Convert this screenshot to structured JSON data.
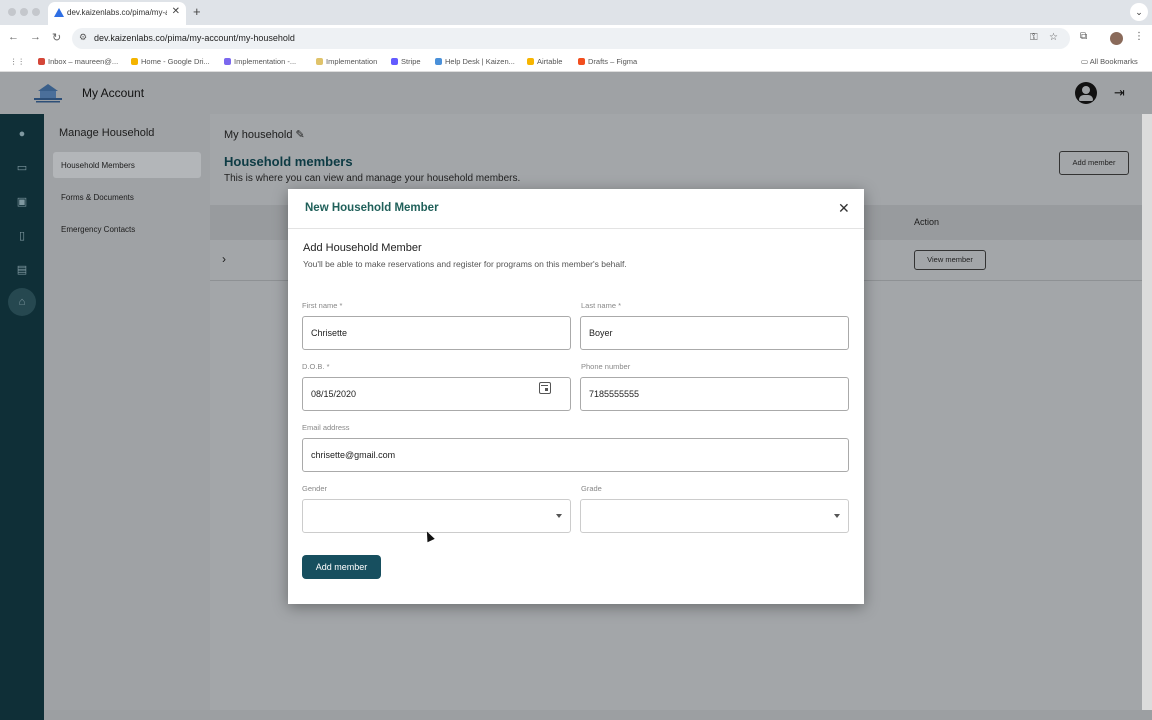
{
  "browser": {
    "tab_title": "dev.kaizenlabs.co/pima/my-a",
    "tab_close": "✕",
    "new_tab": "+",
    "tab_menu": "⌄",
    "url": "dev.kaizenlabs.co/pima/my-account/my-household",
    "bookmarks": [
      "Inbox – maureen@...",
      "Home - Google Dri...",
      "Implementation -...",
      "Implementation",
      "Stripe",
      "Help Desk | Kaizen...",
      "Airtable",
      "Drafts – Figma"
    ],
    "all_bookmarks": "All Bookmarks"
  },
  "app": {
    "title": "My Account"
  },
  "sidebar": {
    "title": "Manage Household",
    "items": [
      {
        "label": "Household Members"
      },
      {
        "label": "Forms & Documents"
      },
      {
        "label": "Emergency Contacts"
      }
    ]
  },
  "main": {
    "household_title": "My household",
    "section_title": "Household members",
    "section_sub": "This is where you can view and manage your household members.",
    "add_member": "Add member",
    "table": {
      "action_header": "Action",
      "row_chevron": "›",
      "view_member": "View member"
    }
  },
  "modal": {
    "title": "New Household Member",
    "section_title": "Add Household Member",
    "section_sub": "You'll be able to make reservations and register for programs on this member's behalf.",
    "fields": {
      "first_name": {
        "label": "First name *",
        "value": "Chrisette"
      },
      "last_name": {
        "label": "Last name *",
        "value": "Boyer"
      },
      "dob": {
        "label": "D.O.B. *",
        "value": "08/15/2020"
      },
      "phone": {
        "label": "Phone number",
        "value": "7185555555"
      },
      "email": {
        "label": "Email address",
        "value": "chrisette@gmail.com"
      },
      "gender": {
        "label": "Gender",
        "value": ""
      },
      "grade": {
        "label": "Grade",
        "value": ""
      }
    },
    "submit": "Add member"
  },
  "colors": {
    "accent": "#174f5f",
    "modal_title": "#20605a",
    "rail": "#0f2f37"
  }
}
